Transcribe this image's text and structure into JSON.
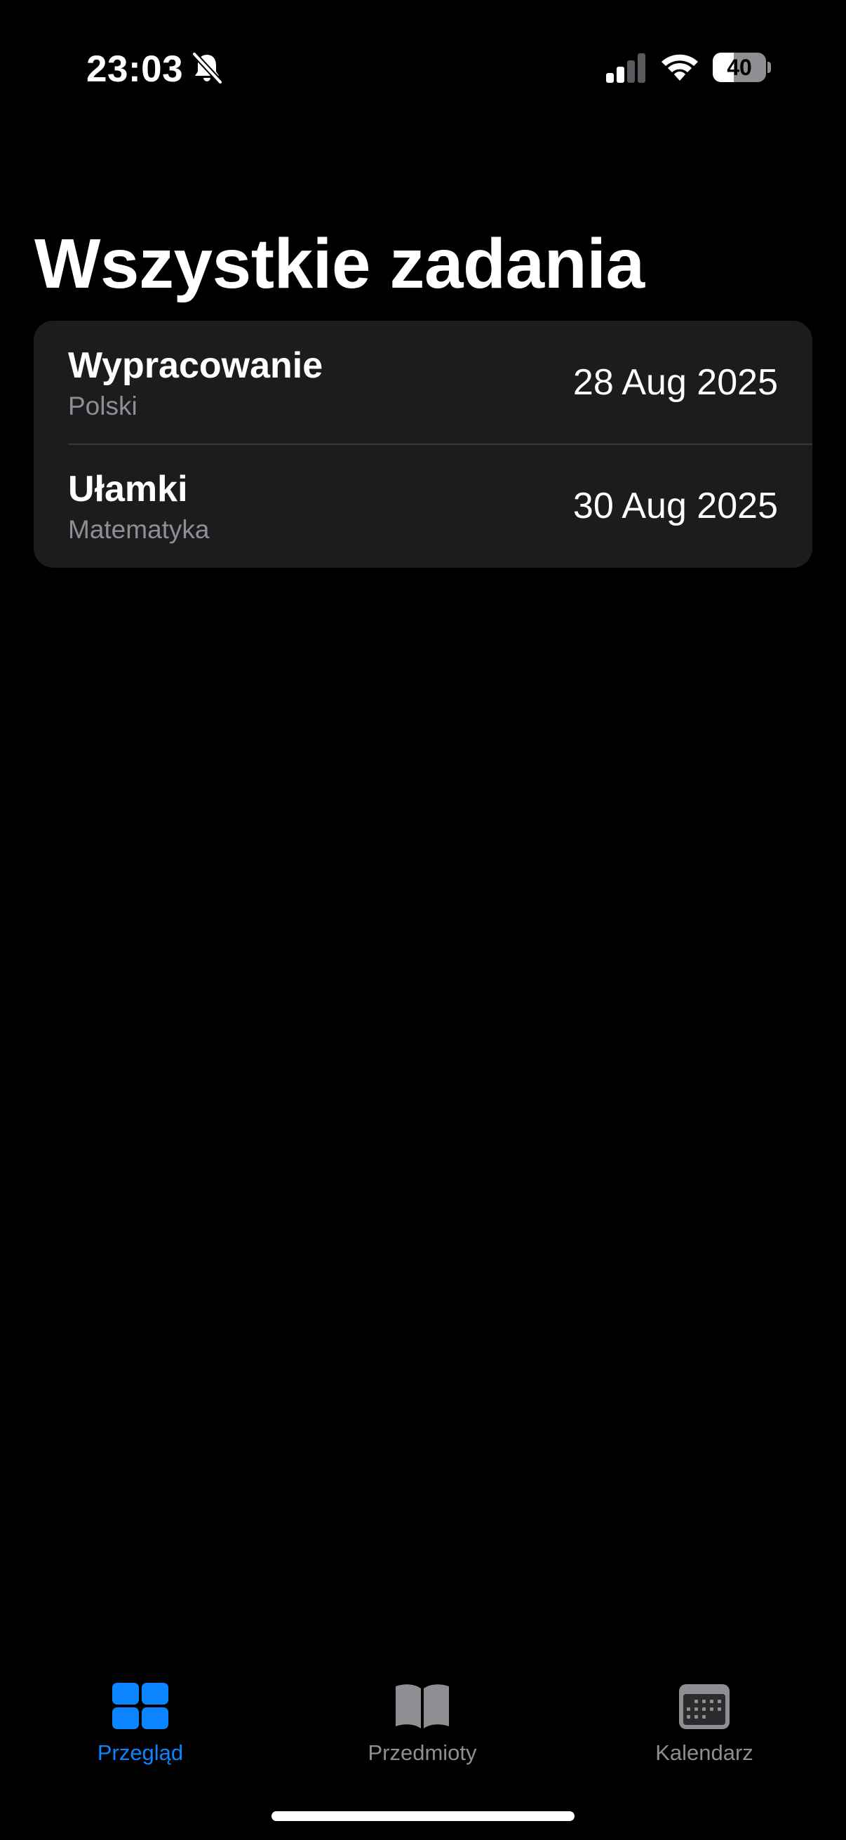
{
  "status_bar": {
    "time": "23:03",
    "battery": {
      "level_percent": 40,
      "label": "40"
    },
    "icons": [
      "bell-slash-icon",
      "cellular-signal-icon",
      "wifi-icon",
      "battery-icon"
    ],
    "signal_bars_active": 2,
    "signal_bars_total": 4
  },
  "page": {
    "title": "Wszystkie zadania"
  },
  "tasks": [
    {
      "title": "Wypracowanie",
      "subject": "Polski",
      "date": "28 Aug 2025"
    },
    {
      "title": "Ułamki",
      "subject": "Matematyka",
      "date": "30 Aug 2025"
    }
  ],
  "tab_bar": {
    "tabs": [
      {
        "label": "Przegląd",
        "icon": "grid-icon",
        "active": true
      },
      {
        "label": "Przedmioty",
        "icon": "book-icon",
        "active": false
      },
      {
        "label": "Kalendarz",
        "icon": "calendar-icon",
        "active": false
      }
    ]
  },
  "colors": {
    "background": "#000000",
    "card": "#1c1c1e",
    "accent": "#0a84ff",
    "secondary_text": "#8e8e93",
    "separator": "#38383a"
  }
}
